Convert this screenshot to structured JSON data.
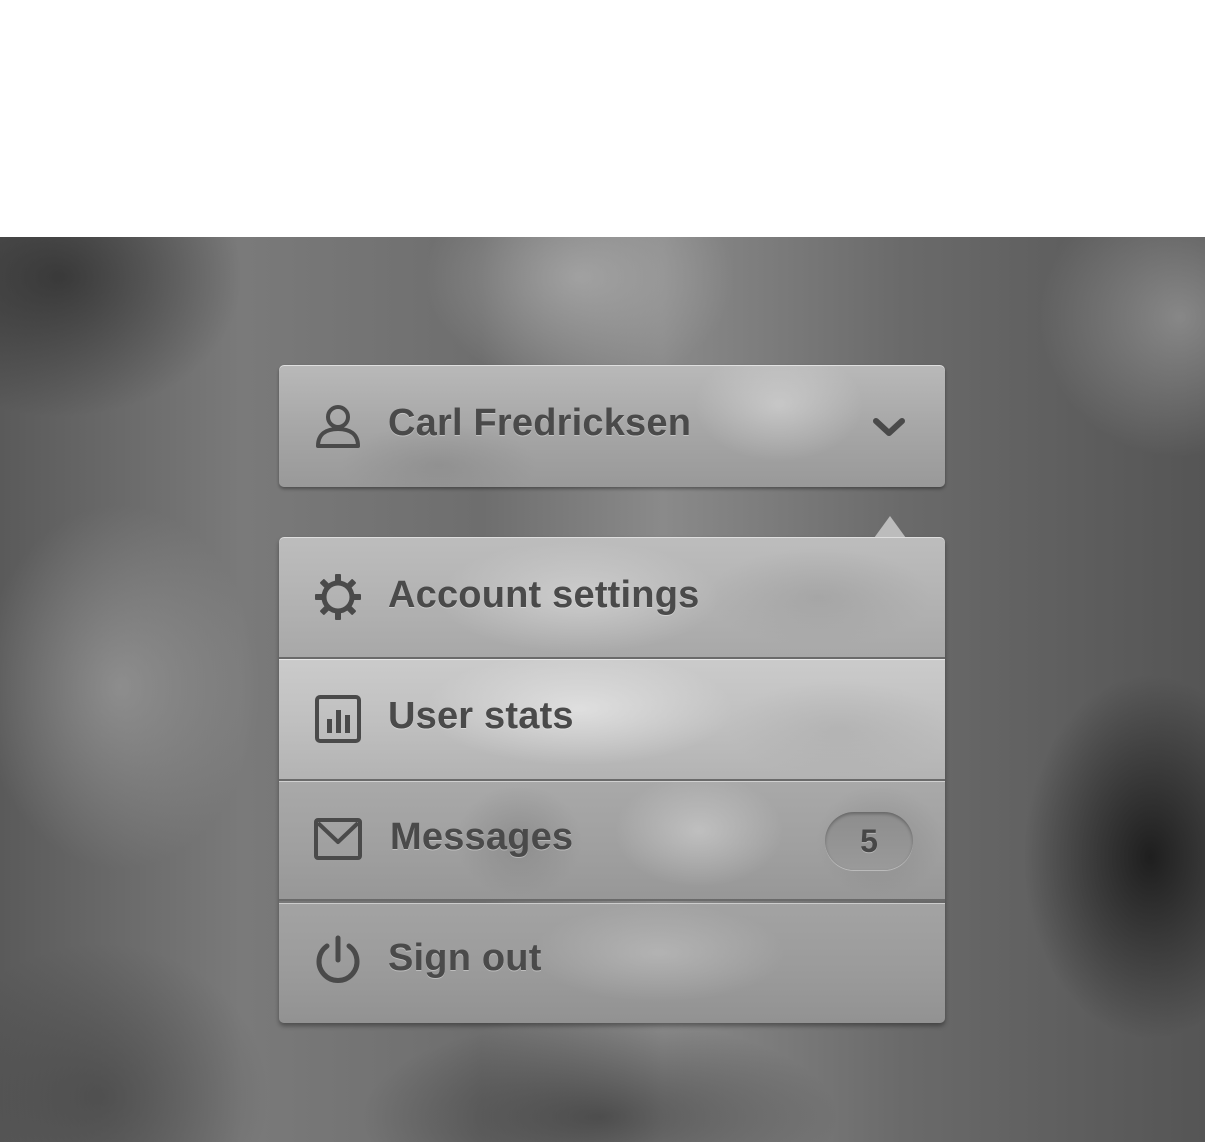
{
  "user_button": {
    "name": "Carl Fredricksen",
    "icon": "user-icon",
    "toggle_icon": "chevron-down-icon"
  },
  "menu": {
    "items": [
      {
        "label": "Account settings",
        "icon": "gear-icon"
      },
      {
        "label": "User stats",
        "icon": "bar-chart-icon"
      },
      {
        "label": "Messages",
        "icon": "envelope-icon",
        "badge": "5"
      },
      {
        "label": "Sign out",
        "icon": "power-icon"
      }
    ]
  },
  "colors": {
    "text": "#4a4a4a",
    "panel": "#b2b2b2",
    "divider": "#6a6a6a"
  }
}
